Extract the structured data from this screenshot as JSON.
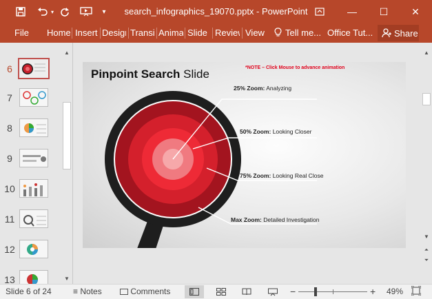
{
  "window": {
    "title": "search_infographics_19070.pptx - PowerPoint",
    "minimize_glyph": "—",
    "maximize_glyph": "☐",
    "close_glyph": "✕"
  },
  "ribbon": {
    "tabs": [
      "File",
      "Home",
      "Insert",
      "Design",
      "Transitions",
      "Animations",
      "Slide Show",
      "Review",
      "View"
    ],
    "tell_me": "Tell me...",
    "office_tut": "Office Tut...",
    "share": "Share"
  },
  "thumbnails": {
    "numbers": [
      "6",
      "7",
      "8",
      "9",
      "10",
      "11",
      "12",
      "13"
    ],
    "active": "6"
  },
  "slide": {
    "title_bold": "Pinpoint Search",
    "title_rest": " Slide",
    "note": "*NOTE – Click Mouse to advance animation",
    "zoom_labels": [
      {
        "bold": "25% Zoom:",
        "text": " Analyzing"
      },
      {
        "bold": "50% Zoom:",
        "text": " Looking Closer"
      },
      {
        "bold": "75% Zoom:",
        "text": " Looking Real Close"
      },
      {
        "bold": "Max Zoom:",
        "text": " Detailed Investigation"
      }
    ],
    "colors": {
      "ring_outer": "#a3141f",
      "ring_mid": "#d4202c",
      "ring_inner": "#ee5a62",
      "center": "#f6a8aa",
      "lens_frame": "#1e1e1e",
      "label_line": "#ffffff"
    }
  },
  "statusbar": {
    "slide_info": "Slide 6 of 24",
    "notes": "Notes",
    "comments": "Comments",
    "zoom_minus": "−",
    "zoom_plus": "+",
    "zoom_level": "49%",
    "zoom_fraction": 0.49
  }
}
